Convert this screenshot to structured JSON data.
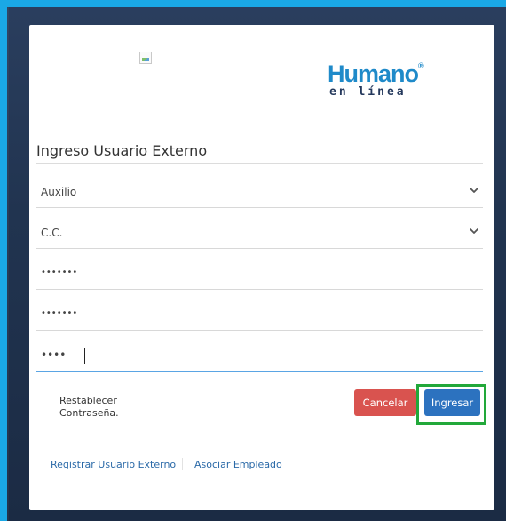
{
  "brand": {
    "logo_top": "Humano",
    "logo_reg": "®",
    "logo_bottom": "en línea"
  },
  "form": {
    "title": "Ingreso Usuario Externo",
    "fields": [
      {
        "type": "select",
        "value": "Auxilio"
      },
      {
        "type": "select",
        "value": "C.C."
      },
      {
        "type": "password",
        "value": "•••••••"
      },
      {
        "type": "password",
        "value": "•••••••"
      },
      {
        "type": "password",
        "value": "••••"
      }
    ]
  },
  "actions": {
    "reset_password": "Restablecer Contraseña.",
    "cancel_label": "Cancelar",
    "submit_label": "Ingresar"
  },
  "links": {
    "register": "Registrar Usuario Externo",
    "associate": "Asociar Empleado"
  },
  "colors": {
    "frame": "#1aa8e6",
    "brand_blue": "#1f8ac9",
    "cancel": "#d9534f",
    "submit": "#2c72bf",
    "highlight": "#22a83a",
    "link": "#2b6aa8"
  },
  "icons": {
    "select_arrow": "chevron-down-icon",
    "broken_image": "broken-image-icon"
  }
}
